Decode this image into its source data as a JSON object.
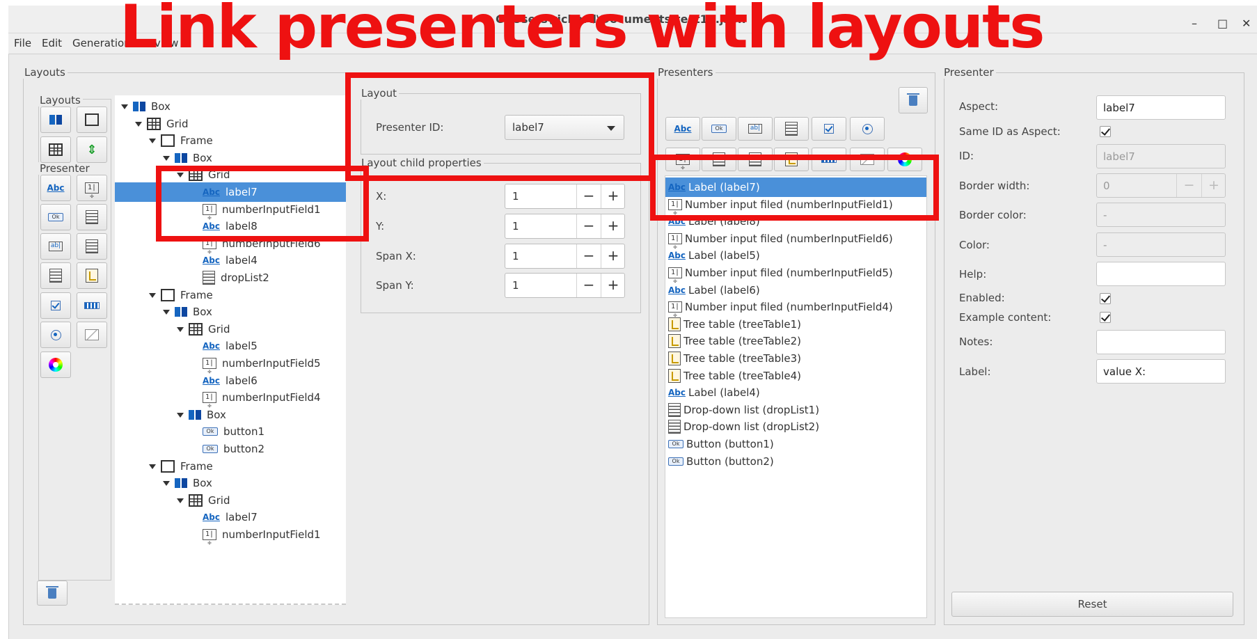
{
  "window": {
    "title": "C:\\Users\\richard\\Documents\\test12.json",
    "controls": [
      "–",
      "□",
      "✕"
    ]
  },
  "menu": [
    "File",
    "Edit",
    "Generation",
    "Preview"
  ],
  "annotation": {
    "title": "Link presenters with layouts"
  },
  "layouts_panel": {
    "title": "Layouts",
    "toolbox_layouts_label": "Layouts",
    "toolbox_presenter_label": "Presenter",
    "tree": [
      {
        "label": "Box",
        "icon": "box-icon",
        "depth": 0,
        "expanded": true,
        "selected": false
      },
      {
        "label": "Grid",
        "icon": "grid-icon",
        "depth": 1,
        "expanded": true,
        "selected": false
      },
      {
        "label": "Frame",
        "icon": "frame-icon",
        "depth": 2,
        "expanded": true,
        "selected": false
      },
      {
        "label": "Box",
        "icon": "box-icon",
        "depth": 3,
        "expanded": true,
        "selected": false
      },
      {
        "label": "Grid",
        "icon": "grid-icon",
        "depth": 4,
        "expanded": true,
        "selected": false
      },
      {
        "label": "label7",
        "icon": "label-icon",
        "depth": 5,
        "expanded": null,
        "selected": true
      },
      {
        "label": "numberInputField1",
        "icon": "number-input-icon",
        "depth": 5,
        "expanded": null,
        "selected": false
      },
      {
        "label": "label8",
        "icon": "label-icon",
        "depth": 5,
        "expanded": null,
        "selected": false
      },
      {
        "label": "numberInputField6",
        "icon": "number-input-icon",
        "depth": 5,
        "expanded": null,
        "selected": false
      },
      {
        "label": "label4",
        "icon": "label-icon",
        "depth": 5,
        "expanded": null,
        "selected": false
      },
      {
        "label": "dropList2",
        "icon": "drop-list-icon",
        "depth": 5,
        "expanded": null,
        "selected": false
      },
      {
        "label": "Frame",
        "icon": "frame-icon",
        "depth": 2,
        "expanded": true,
        "selected": false
      },
      {
        "label": "Box",
        "icon": "box-icon",
        "depth": 3,
        "expanded": true,
        "selected": false
      },
      {
        "label": "Grid",
        "icon": "grid-icon",
        "depth": 4,
        "expanded": true,
        "selected": false
      },
      {
        "label": "label5",
        "icon": "label-icon",
        "depth": 5,
        "expanded": null,
        "selected": false
      },
      {
        "label": "numberInputField5",
        "icon": "number-input-icon",
        "depth": 5,
        "expanded": null,
        "selected": false
      },
      {
        "label": "label6",
        "icon": "label-icon",
        "depth": 5,
        "expanded": null,
        "selected": false
      },
      {
        "label": "numberInputField4",
        "icon": "number-input-icon",
        "depth": 5,
        "expanded": null,
        "selected": false
      },
      {
        "label": "Box",
        "icon": "box-icon",
        "depth": 4,
        "expanded": true,
        "selected": false
      },
      {
        "label": "button1",
        "icon": "button-icon",
        "depth": 5,
        "expanded": null,
        "selected": false
      },
      {
        "label": "button2",
        "icon": "button-icon",
        "depth": 5,
        "expanded": null,
        "selected": false
      },
      {
        "label": "Frame",
        "icon": "frame-icon",
        "depth": 2,
        "expanded": true,
        "selected": false
      },
      {
        "label": "Box",
        "icon": "box-icon",
        "depth": 3,
        "expanded": true,
        "selected": false
      },
      {
        "label": "Grid",
        "icon": "grid-icon",
        "depth": 4,
        "expanded": true,
        "selected": false
      },
      {
        "label": "label7",
        "icon": "label-icon",
        "depth": 5,
        "expanded": null,
        "selected": false
      },
      {
        "label": "numberInputField1",
        "icon": "number-input-icon",
        "depth": 5,
        "expanded": null,
        "selected": false
      }
    ]
  },
  "layout_panel": {
    "title": "Layout",
    "presenter_id_label": "Presenter ID:",
    "presenter_id_value": "label7",
    "child_props_title": "Layout child properties",
    "fields": [
      {
        "label": "X:",
        "value": "1"
      },
      {
        "label": "Y:",
        "value": "1"
      },
      {
        "label": "Span X:",
        "value": "1"
      },
      {
        "label": "Span Y:",
        "value": "1"
      }
    ],
    "minus": "−",
    "plus": "+"
  },
  "presenters_panel": {
    "title": "Presenters",
    "items": [
      {
        "label": "Label (label7)",
        "icon": "label-icon",
        "selected": true
      },
      {
        "label": "Number input filed (numberInputField1)",
        "icon": "number-input-icon",
        "selected": false
      },
      {
        "label": "Label (label8)",
        "icon": "label-icon",
        "selected": false
      },
      {
        "label": "Number input filed (numberInputField6)",
        "icon": "number-input-icon",
        "selected": false
      },
      {
        "label": "Label (label5)",
        "icon": "label-icon",
        "selected": false
      },
      {
        "label": "Number input filed (numberInputField5)",
        "icon": "number-input-icon",
        "selected": false
      },
      {
        "label": "Label (label6)",
        "icon": "label-icon",
        "selected": false
      },
      {
        "label": "Number input filed (numberInputField4)",
        "icon": "number-input-icon",
        "selected": false
      },
      {
        "label": "Tree table (treeTable1)",
        "icon": "tree-table-icon",
        "selected": false
      },
      {
        "label": "Tree table (treeTable2)",
        "icon": "tree-table-icon",
        "selected": false
      },
      {
        "label": "Tree table (treeTable3)",
        "icon": "tree-table-icon",
        "selected": false
      },
      {
        "label": "Tree table (treeTable4)",
        "icon": "tree-table-icon",
        "selected": false
      },
      {
        "label": "Label (label4)",
        "icon": "label-icon",
        "selected": false
      },
      {
        "label": "Drop-down list (dropList1)",
        "icon": "drop-list-icon",
        "selected": false
      },
      {
        "label": "Drop-down list (dropList2)",
        "icon": "drop-list-icon",
        "selected": false
      },
      {
        "label": "Button (button1)",
        "icon": "button-icon",
        "selected": false
      },
      {
        "label": "Button (button2)",
        "icon": "button-icon",
        "selected": false
      }
    ]
  },
  "presenter_panel": {
    "title": "Presenter",
    "aspect_label": "Aspect:",
    "aspect_value": "label7",
    "same_id_label": "Same ID as Aspect:",
    "same_id_checked": true,
    "id_label": "ID:",
    "id_value": "label7",
    "border_width_label": "Border width:",
    "border_width_value": "0",
    "border_color_label": "Border color:",
    "border_color_value": "-",
    "color_label": "Color:",
    "color_value": "-",
    "help_label": "Help:",
    "help_value": "",
    "enabled_label": "Enabled:",
    "enabled_checked": true,
    "example_content_label": "Example content:",
    "example_content_checked": true,
    "notes_label": "Notes:",
    "notes_value": "",
    "label_label": "Label:",
    "label_value": "value X:",
    "reset_label": "Reset",
    "minus": "−",
    "plus": "+"
  },
  "colors": {
    "selection": "#4a90d9",
    "annotation_red": "#ee1111",
    "accent_blue": "#1565c0"
  }
}
